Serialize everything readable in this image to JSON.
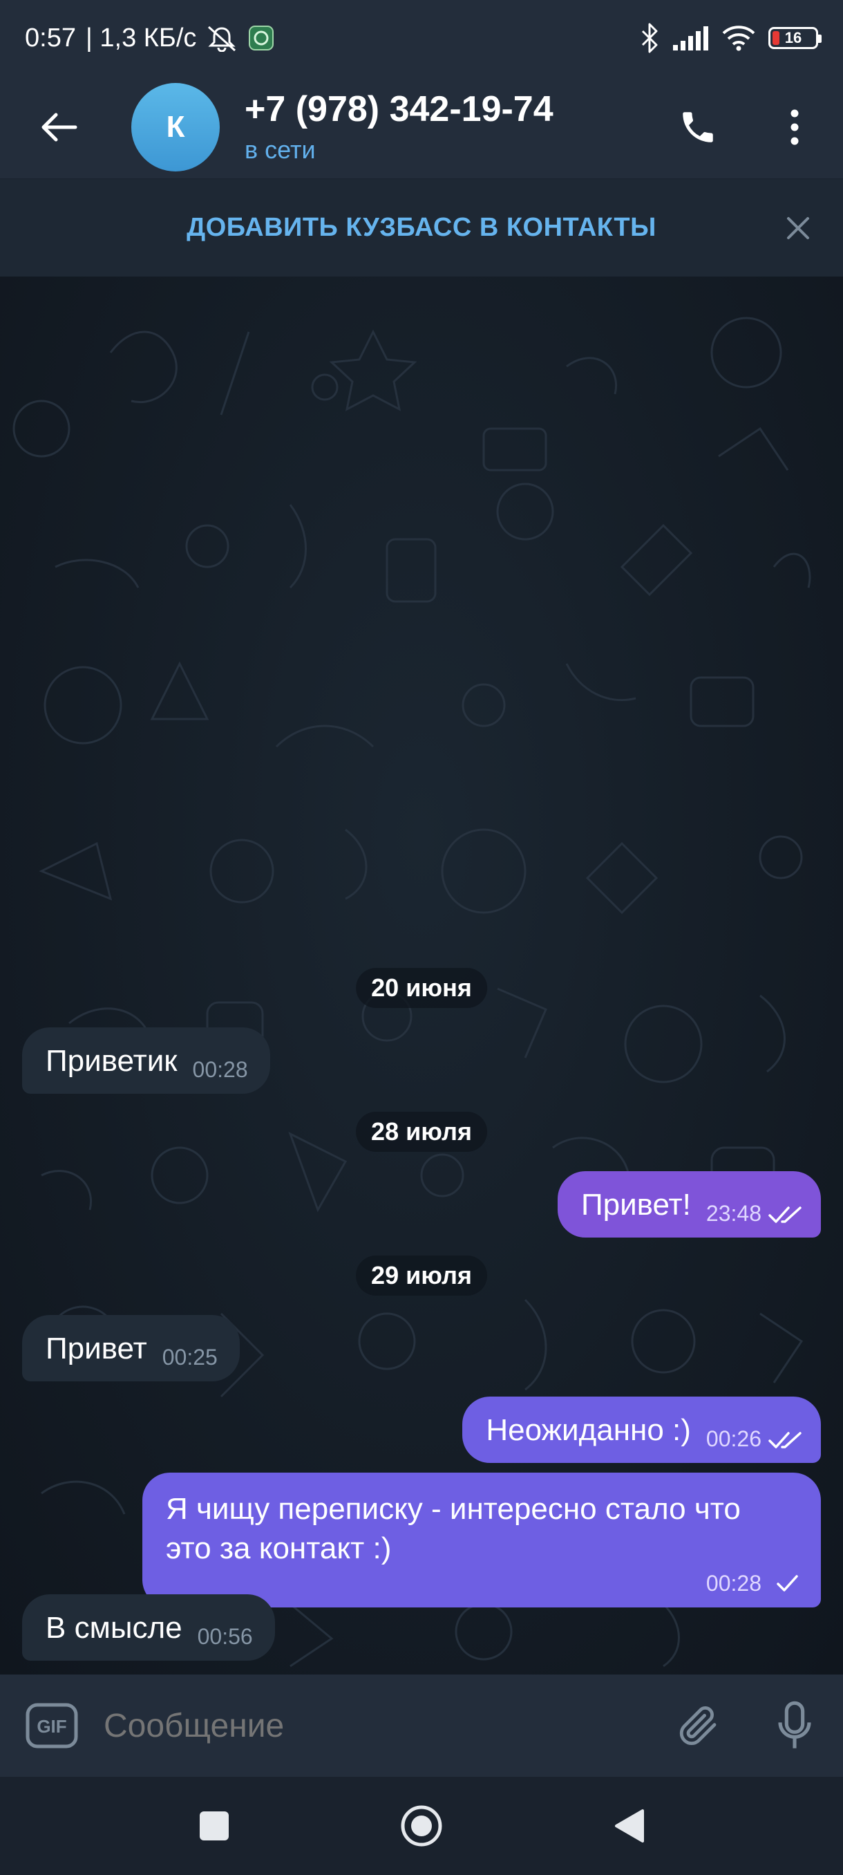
{
  "status_bar": {
    "time": "0:57",
    "speed": "| 1,3 КБ/с",
    "battery": "16"
  },
  "header": {
    "avatar_letter": "К",
    "title": "+7 (978) 342-19-74",
    "status": "в сети"
  },
  "banner": {
    "text": "ДОБАВИТЬ КУЗБАСС В КОНТАКТЫ"
  },
  "messages": [
    {
      "type": "date",
      "text": "20 июня"
    },
    {
      "type": "in",
      "text": "Приветик",
      "time": "00:28"
    },
    {
      "type": "date",
      "text": "28 июля"
    },
    {
      "type": "out",
      "text": "Привет!",
      "time": "23:48",
      "status": "read"
    },
    {
      "type": "date",
      "text": "29 июля"
    },
    {
      "type": "in",
      "text": "Привет",
      "time": "00:25"
    },
    {
      "type": "out",
      "text": "Неожиданно :)",
      "time": "00:26",
      "status": "read"
    },
    {
      "type": "out",
      "text_line1": "Я чищу переписку - интересно стало что",
      "text_line2": "это за контакт :)",
      "time": "00:28",
      "status": "sent"
    },
    {
      "type": "in",
      "text": "В смысле",
      "time": "00:56"
    }
  ],
  "input": {
    "placeholder": "Сообщение"
  },
  "colors": {
    "accent": "#62b0ec",
    "outgoing_bubble": "#7f54d9",
    "outgoing_bubble_alt": "#6e5fe3",
    "incoming_bubble": "#212c38",
    "header_bg": "#232d3b"
  },
  "icons": {
    "back": "arrow-left-icon",
    "call": "phone-icon",
    "menu": "more-vertical-icon",
    "close": "close-icon",
    "gif": "gif-icon",
    "attach": "paperclip-icon",
    "mic": "microphone-icon"
  }
}
